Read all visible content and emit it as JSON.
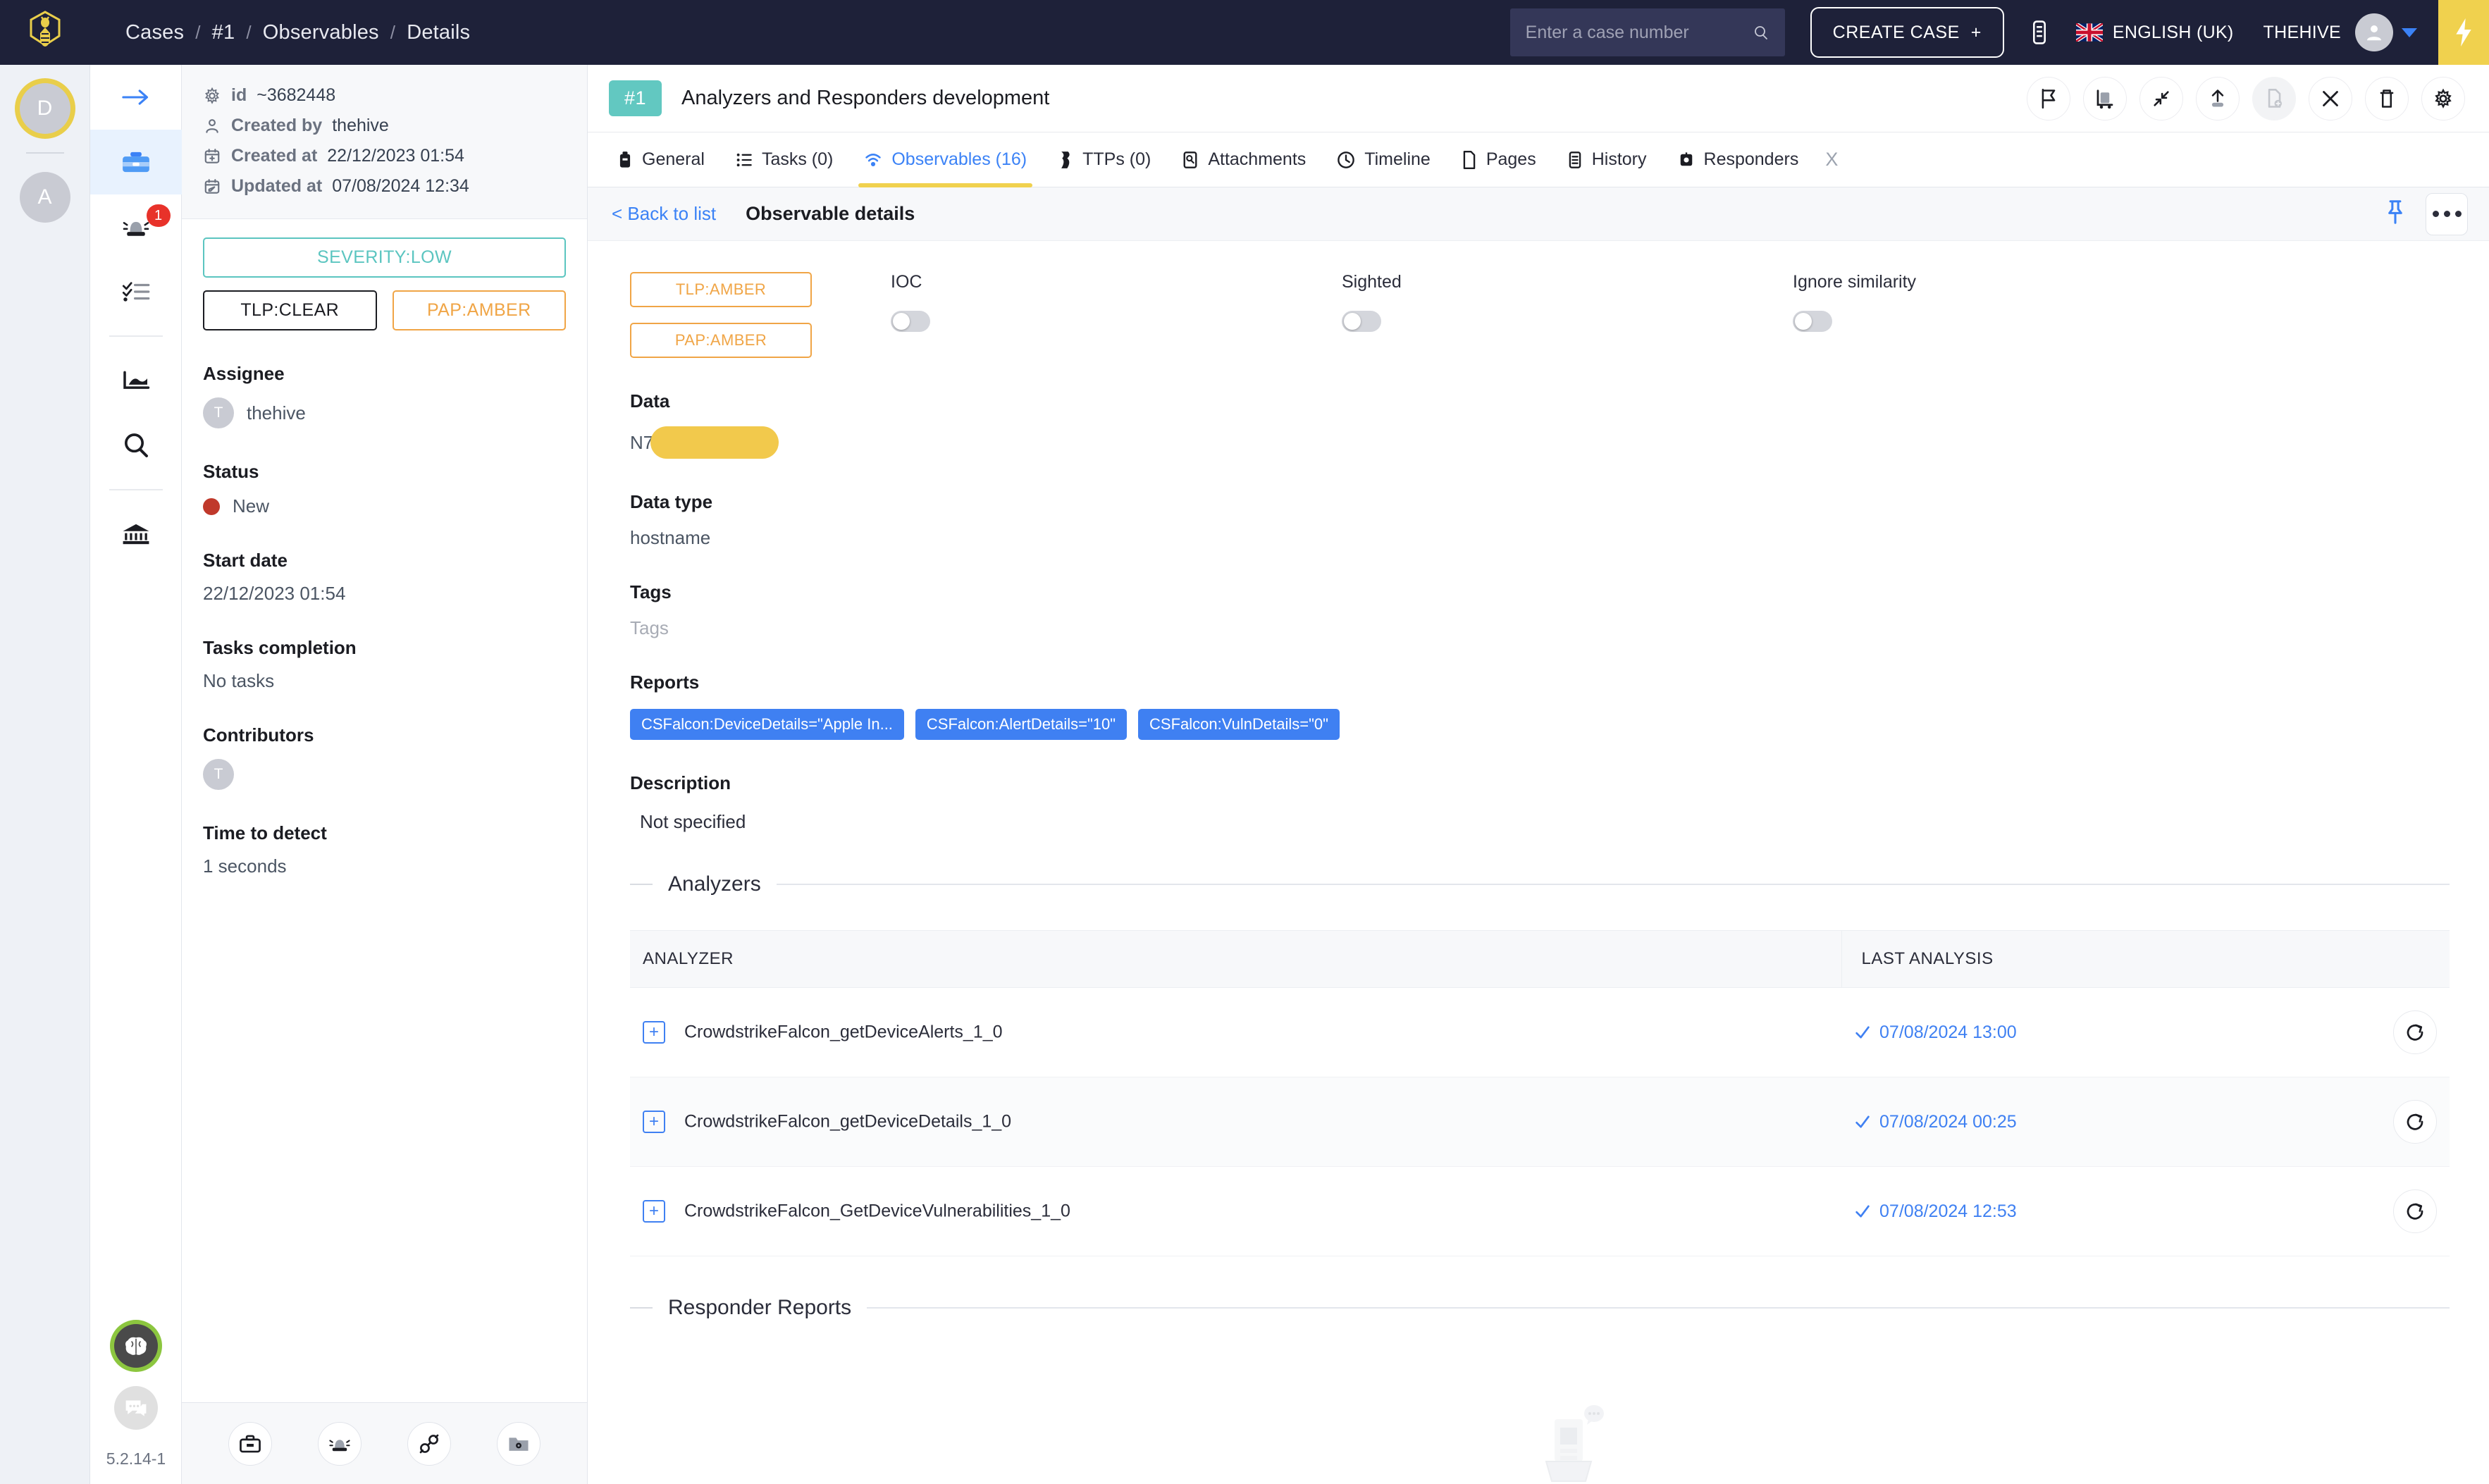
{
  "topbar": {
    "logo_name": "thehive-bee-logo",
    "breadcrumb": [
      "Cases",
      "#1",
      "Observables",
      "Details"
    ],
    "search": {
      "placeholder": "Enter a case number",
      "value": ""
    },
    "create_case_label": "CREATE CASE",
    "create_case_plus": "+",
    "language": "ENGLISH (UK)",
    "user": "THEHIVE"
  },
  "org_rail": {
    "items": [
      {
        "initial": "D",
        "active": true
      },
      {
        "initial": "A",
        "active": false
      }
    ]
  },
  "nav_rail": {
    "items": [
      {
        "name": "arrow-right-icon",
        "badge": ""
      },
      {
        "name": "cases-briefcase-icon",
        "badge": "",
        "active": true
      },
      {
        "name": "alerts-siren-icon",
        "badge": "1"
      },
      {
        "name": "tasks-list-icon",
        "badge": ""
      },
      {
        "name": "dashboard-chart-icon",
        "badge": ""
      },
      {
        "name": "search-icon",
        "badge": ""
      },
      {
        "name": "organisation-bank-icon",
        "badge": ""
      }
    ],
    "brain_icon": "brain-icon",
    "chat_icon": "chat-icon",
    "version": "5.2.14-1"
  },
  "case_panel": {
    "meta": [
      {
        "icon": "gear-icon",
        "key": "id",
        "value": "~3682448"
      },
      {
        "icon": "user-icon",
        "key": "Created by",
        "value": "thehive"
      },
      {
        "icon": "calendar-add-icon",
        "key": "Created at",
        "value": "22/12/2023 01:54"
      },
      {
        "icon": "calendar-edit-icon",
        "key": "Updated at",
        "value": "07/08/2024 12:34"
      }
    ],
    "severity": "SEVERITY:LOW",
    "tlp": "TLP:CLEAR",
    "pap": "PAP:AMBER",
    "assignee_label": "Assignee",
    "assignee_name": "thehive",
    "assignee_initial": "T",
    "status_label": "Status",
    "status_value": "New",
    "start_date_label": "Start date",
    "start_date_value": "22/12/2023 01:54",
    "tasks_completion_label": "Tasks completion",
    "tasks_completion_value": "No tasks",
    "contributors_label": "Contributors",
    "contributor_initial": "T",
    "time_to_detect_label": "Time to detect",
    "time_to_detect_value": "1 seconds",
    "footer_icons": [
      "case-briefcase-icon",
      "alert-siren-icon",
      "link-connector-icon",
      "folder-gear-icon"
    ]
  },
  "case_header": {
    "case_number": "#1",
    "title": "Analyzers and Responders development",
    "actions": [
      "flag-icon",
      "cart-icon",
      "collapse-icon",
      "export-upload-icon",
      "add-document-icon",
      "close-icon",
      "delete-trash-icon",
      "settings-gear-icon"
    ]
  },
  "tabs": [
    {
      "icon": "general-icon",
      "label": "General",
      "active": false
    },
    {
      "icon": "tasks-icon",
      "label": "Tasks (0)",
      "active": false
    },
    {
      "icon": "observables-icon",
      "label": "Observables (16)",
      "active": true
    },
    {
      "icon": "ttps-icon",
      "label": "TTPs (0)",
      "active": false
    },
    {
      "icon": "attachments-icon",
      "label": "Attachments",
      "active": false
    },
    {
      "icon": "timeline-clock-icon",
      "label": "Timeline",
      "active": false
    },
    {
      "icon": "pages-icon",
      "label": "Pages",
      "active": false
    },
    {
      "icon": "history-icon",
      "label": "History",
      "active": false
    },
    {
      "icon": "responders-icon",
      "label": "Responders",
      "active": false
    }
  ],
  "tab_close_label": "X",
  "observable": {
    "back_link": "< Back to list",
    "title": "Observable details",
    "tlp": "TLP:AMBER",
    "pap": "PAP:AMBER",
    "ioc_label": "IOC",
    "ioc_on": false,
    "sighted_label": "Sighted",
    "sighted_on": false,
    "ignore_similarity_label": "Ignore similarity",
    "ignore_similarity_on": false,
    "data_label": "Data",
    "data_value": "N7",
    "data_redacted": true,
    "data_type_label": "Data type",
    "data_type_value": "hostname",
    "tags_label": "Tags",
    "tags_placeholder": "Tags",
    "reports_label": "Reports",
    "reports": [
      "CSFalcon:DeviceDetails=\"Apple In...",
      "CSFalcon:AlertDetails=\"10\"",
      "CSFalcon:VulnDetails=\"0\""
    ],
    "description_label": "Description",
    "description_value": "Not specified"
  },
  "analyzers_section": {
    "title": "Analyzers",
    "columns": [
      "ANALYZER",
      "LAST ANALYSIS",
      ""
    ],
    "rows": [
      {
        "name": "CrowdstrikeFalcon_getDeviceAlerts_1_0",
        "last_analysis": "07/08/2024 13:00",
        "status": "success"
      },
      {
        "name": "CrowdstrikeFalcon_getDeviceDetails_1_0",
        "last_analysis": "07/08/2024 00:25",
        "status": "success"
      },
      {
        "name": "CrowdstrikeFalcon_GetDeviceVulnerabilities_1_0",
        "last_analysis": "07/08/2024 12:53",
        "status": "success"
      }
    ]
  },
  "responder_section": {
    "title": "Responder Reports"
  },
  "colors": {
    "topbar_bg": "#1e2139",
    "accent_yellow": "#f0d14e",
    "link_blue": "#3b82f6",
    "badge_blue": "#3f80f2",
    "teal": "#62c8c1",
    "amber": "#f0a546",
    "status_red": "#c0392b",
    "green_ring": "#8cc63f",
    "redaction": "#f2c94c"
  }
}
